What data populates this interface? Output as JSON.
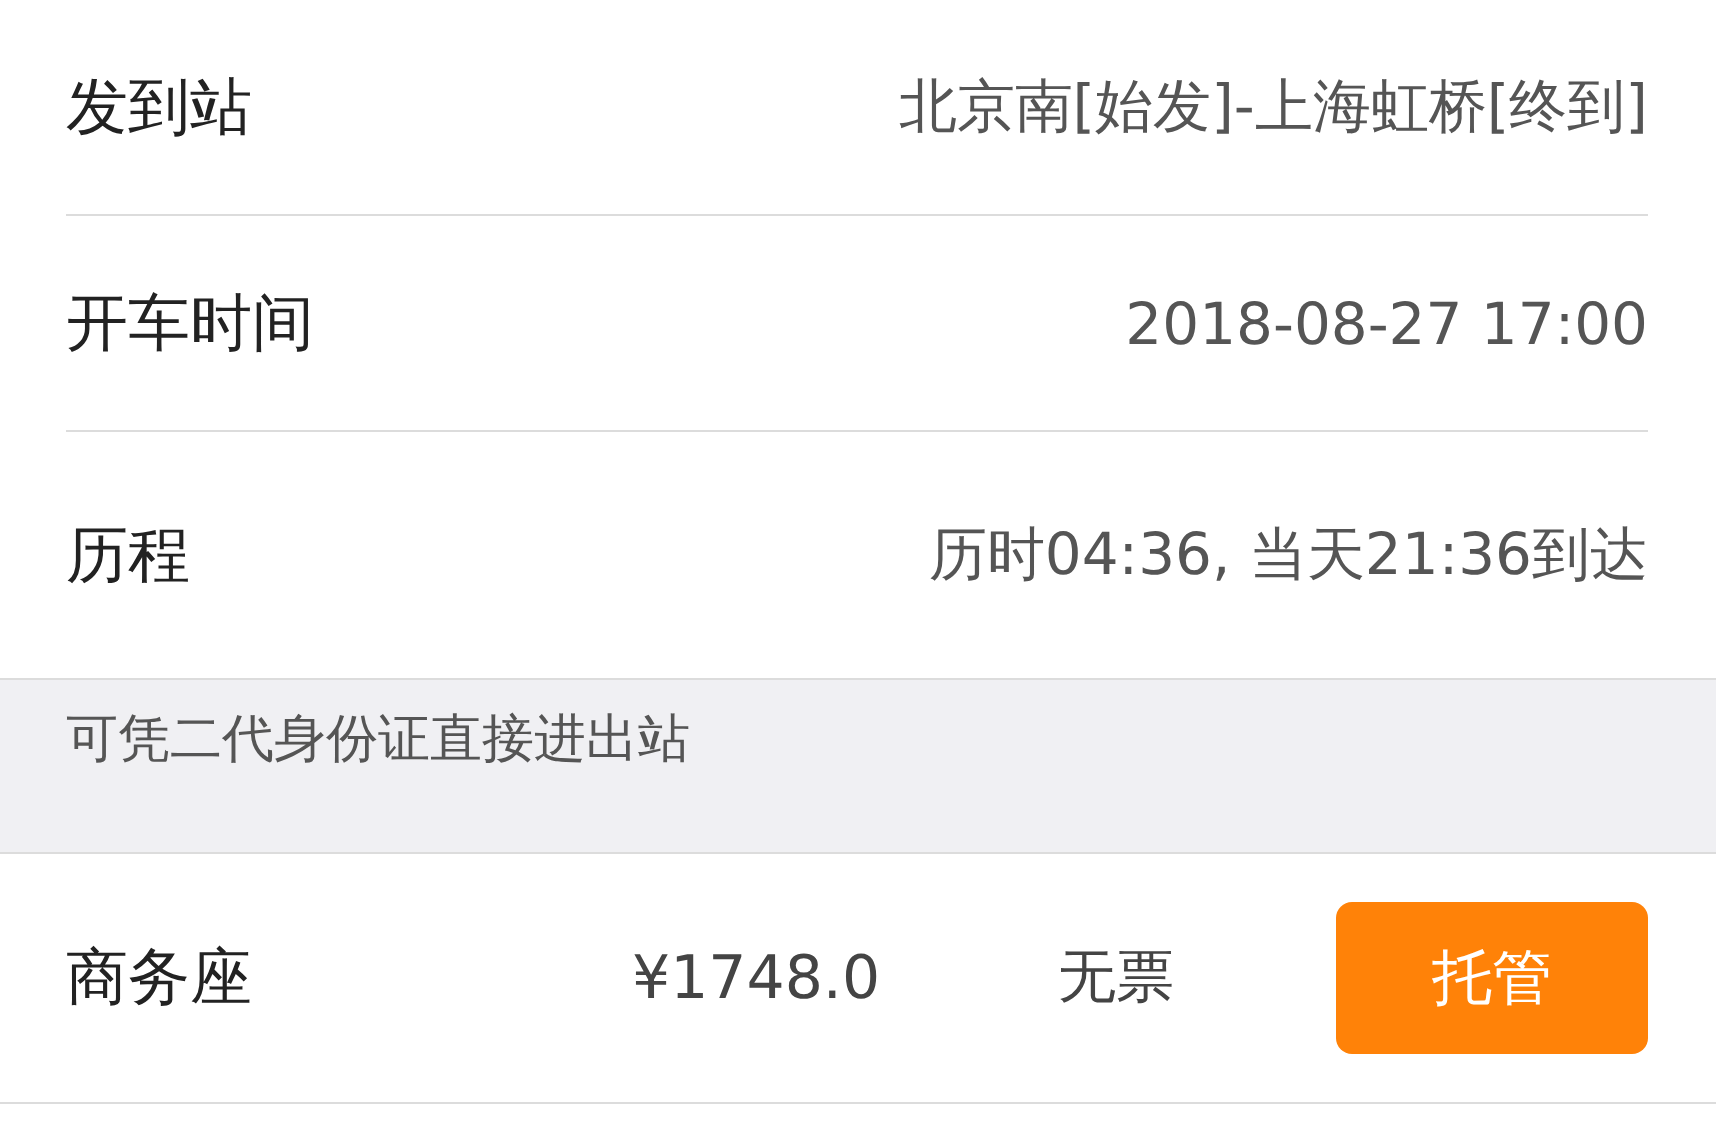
{
  "details": [
    {
      "label": "发到站",
      "value": "北京南[始发]-上海虹桥[终到]"
    },
    {
      "label": "开车时间",
      "value": "2018-08-27 17:00"
    },
    {
      "label": "历程",
      "value": "历时04:36, 当天21:36到达"
    }
  ],
  "notice": "可凭二代身份证直接进出站",
  "seats": [
    {
      "name": "商务座",
      "price": "¥1748.0",
      "availability": "无票",
      "action": "托管"
    }
  ]
}
